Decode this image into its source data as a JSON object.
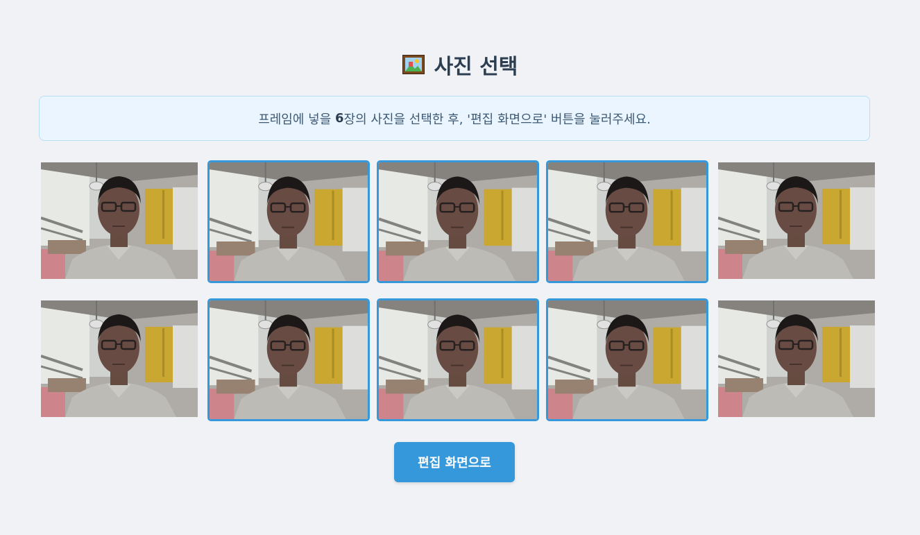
{
  "header": {
    "icon": "framed-picture-icon",
    "title": "사진 선택"
  },
  "notice": {
    "prefix": "프레임에 넣을 ",
    "count": "6",
    "suffix": "장의 사진을 선택한 후, '편집 화면으로' 버튼을 눌러주세요."
  },
  "photos": [
    {
      "id": 1,
      "selected": false
    },
    {
      "id": 2,
      "selected": true
    },
    {
      "id": 3,
      "selected": true
    },
    {
      "id": 4,
      "selected": true
    },
    {
      "id": 5,
      "selected": false
    },
    {
      "id": 6,
      "selected": false
    },
    {
      "id": 7,
      "selected": true
    },
    {
      "id": 8,
      "selected": true
    },
    {
      "id": 9,
      "selected": true
    },
    {
      "id": 10,
      "selected": false
    }
  ],
  "actions": {
    "edit_label": "편집 화면으로"
  },
  "colors": {
    "background": "#f0f2f6",
    "accent": "#3498db",
    "notice_bg": "#eaf5ff",
    "notice_border": "#b6e0f7",
    "title": "#2c3e50"
  }
}
